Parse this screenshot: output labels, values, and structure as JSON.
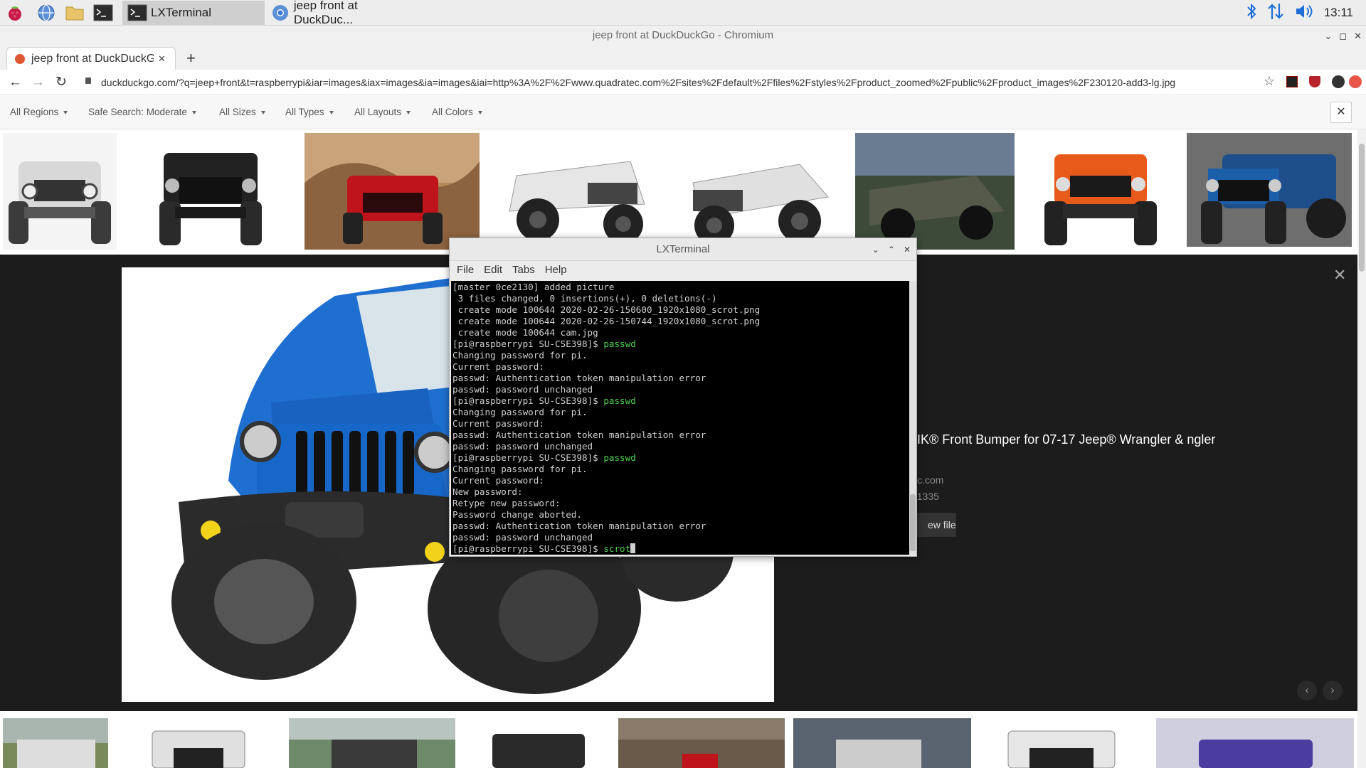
{
  "taskbar": {
    "tasks": [
      {
        "label": "LXTerminal",
        "icon": "terminal-icon"
      },
      {
        "label": "jeep front at DuckDuc...",
        "icon": "chromium-icon"
      }
    ],
    "clock": "13:11"
  },
  "browser": {
    "window_title": "jeep front at DuckDuckGo - Chromium",
    "tab_title": "jeep front at DuckDuckG",
    "url": "duckduckgo.com/?q=jeep+front&t=raspberrypi&iar=images&iax=images&ia=images&iai=http%3A%2F%2Fwww.quadratec.com%2Fsites%2Fdefault%2Ffiles%2Fstyles%2Fproduct_zoomed%2Fpublic%2Fproduct_images%2F230120-add3-lg.jpg"
  },
  "filters": [
    "All Regions",
    "Safe Search: Moderate",
    "All Sizes",
    "All Types",
    "All Layouts",
    "All Colors"
  ],
  "detail": {
    "title": "CTIK® Front Bumper for 07-17 Jeep® Wrangler & ngler ...",
    "source": "ratec.com",
    "dimensions": "0 × 1335",
    "view_file": "ew file"
  },
  "terminal": {
    "title": "LXTerminal",
    "menu": [
      "File",
      "Edit",
      "Tabs",
      "Help"
    ],
    "lines": [
      {
        "text": "[master 0ce2130] added picture"
      },
      {
        "text": " 3 files changed, 0 insertions(+), 0 deletions(-)"
      },
      {
        "text": " create mode 100644 2020-02-26-150600_1920x1080_scrot.png"
      },
      {
        "text": " create mode 100644 2020-02-26-150744_1920x1080_scrot.png"
      },
      {
        "text": " create mode 100644 cam.jpg"
      },
      {
        "prompt": "[pi@raspberrypi SU-CSE398]$ ",
        "cmd": "passwd"
      },
      {
        "text": "Changing password for pi."
      },
      {
        "text": "Current password:"
      },
      {
        "text": "passwd: Authentication token manipulation error"
      },
      {
        "text": "passwd: password unchanged"
      },
      {
        "prompt": "[pi@raspberrypi SU-CSE398]$ ",
        "cmd": "passwd"
      },
      {
        "text": "Changing password for pi."
      },
      {
        "text": "Current password:"
      },
      {
        "text": "passwd: Authentication token manipulation error"
      },
      {
        "text": "passwd: password unchanged"
      },
      {
        "prompt": "[pi@raspberrypi SU-CSE398]$ ",
        "cmd": "passwd"
      },
      {
        "text": "Changing password for pi."
      },
      {
        "text": "Current password:"
      },
      {
        "text": "New password:"
      },
      {
        "text": "Retype new password:"
      },
      {
        "text": "Password change aborted."
      },
      {
        "text": "passwd: Authentication token manipulation error"
      },
      {
        "text": "passwd: password unchanged"
      },
      {
        "prompt": "[pi@raspberrypi SU-CSE398]$ ",
        "cmd": "scrot",
        "cursor": true
      }
    ]
  },
  "colors": {
    "terminal_bg": "#000000",
    "command": "#4fd34f",
    "detail_bg": "#1c1c1c",
    "accent_blue": "#1e6fd8"
  }
}
